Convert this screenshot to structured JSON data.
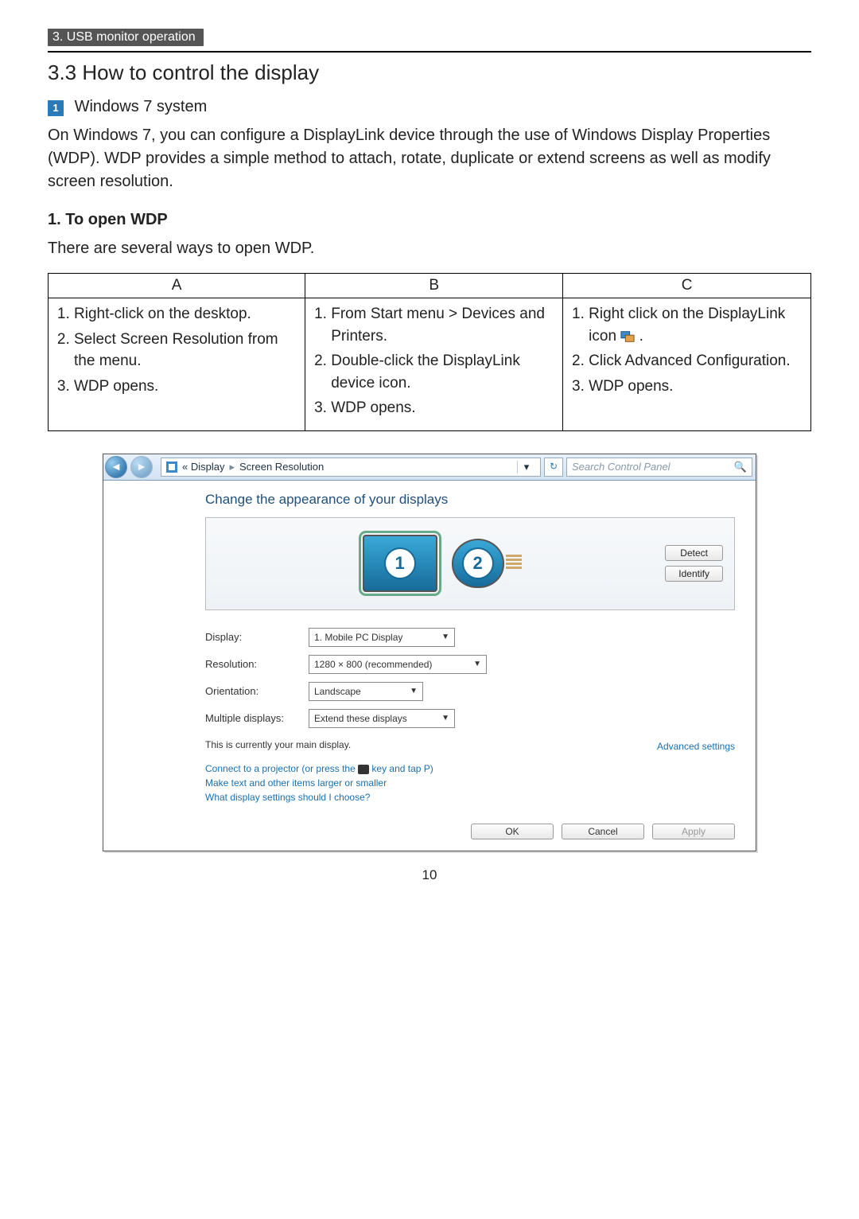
{
  "header": {
    "section_tab": "3. USB monitor operation",
    "title": "3.3  How to control the display",
    "substep_badge": "1",
    "substep_label": "Windows 7 system",
    "intro": "On Windows 7, you can configure a DisplayLink device through the use of Windows Display Properties (WDP). WDP provides a simple method to attach, rotate, duplicate or extend screens as well as modify screen resolution.",
    "step1_heading": "1.   To open WDP",
    "step1_intro": "There are several ways to open WDP."
  },
  "table": {
    "headers": [
      "A",
      "B",
      "C"
    ],
    "colA": [
      "Right-click on the desktop.",
      "Select Screen Resolution from the menu.",
      "WDP opens."
    ],
    "colB": [
      "From Start menu > Devices and Printers.",
      "Double-click the DisplayLink device icon.",
      "WDP opens."
    ],
    "colC": [
      "Right click on the DisplayLink icon ",
      "Click Advanced Configuration.",
      "WDP opens."
    ]
  },
  "wdp": {
    "breadcrumb_part1": "«  Display",
    "breadcrumb_part2": "Screen Resolution",
    "search_placeholder": "Search Control Panel",
    "heading": "Change the appearance of your displays",
    "btn_detect": "Detect",
    "btn_identify": "Identify",
    "monitor1": "1",
    "monitor2": "2",
    "labels": {
      "display": "Display:",
      "resolution": "Resolution:",
      "orientation": "Orientation:",
      "multiple": "Multiple displays:"
    },
    "values": {
      "display": "1. Mobile PC Display",
      "resolution": "1280 × 800 (recommended)",
      "orientation": "Landscape",
      "multiple": "Extend these displays"
    },
    "main_note": "This is currently your main display.",
    "adv_link": "Advanced settings",
    "links": {
      "projector_pre": "Connect to a projector (or press the ",
      "projector_post": " key and tap P)",
      "text_size": "Make text and other items larger or smaller",
      "help": "What display settings should I choose?"
    },
    "buttons": {
      "ok": "OK",
      "cancel": "Cancel",
      "apply": "Apply"
    }
  },
  "page_number": "10"
}
